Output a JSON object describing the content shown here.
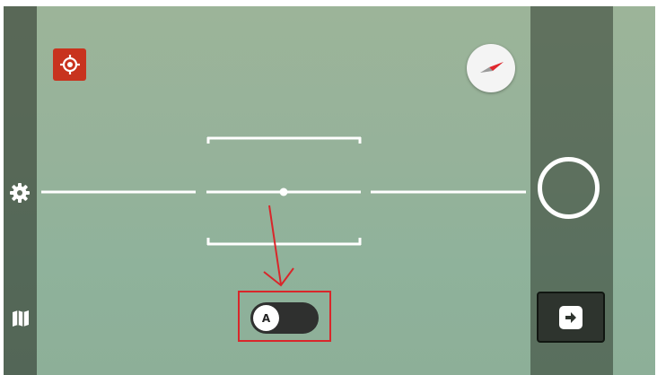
{
  "toolbar": {
    "target_icon": "target-crosshair-icon",
    "compass_icon": "compass-icon",
    "settings_icon": "gear-icon",
    "map_icon": "map-icon",
    "next_icon": "arrow-right-icon"
  },
  "auto_toggle": {
    "label": "A",
    "state": "off"
  },
  "colors": {
    "target_button": "#c8331e",
    "annotation": "#d9262a",
    "toggle_track": "#2f302f",
    "compass_needle": "#e0282e"
  }
}
